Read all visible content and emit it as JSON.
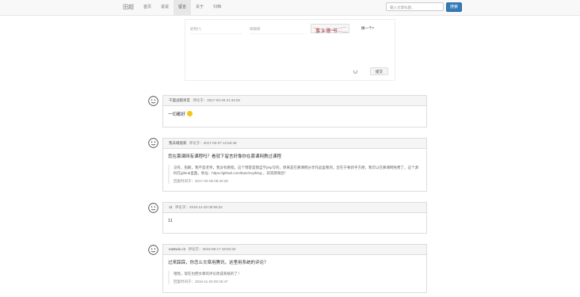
{
  "navbar": {
    "brand": "田超",
    "items": [
      {
        "label": "首页",
        "active": false
      },
      {
        "label": "说说",
        "active": false
      },
      {
        "label": "留言",
        "active": true
      },
      {
        "label": "关于",
        "active": false
      },
      {
        "label": "归档",
        "active": false
      }
    ],
    "search_placeholder": "输入文章标题...",
    "search_button": "搜索"
  },
  "comment_form": {
    "name_placeholder": "昵称(*)",
    "email_placeholder": "邮箱啊",
    "captcha_text": "事 9 歌 书",
    "captcha_refresh": "换一个?",
    "submit_label": "提交"
  },
  "comments": [
    {
      "user": "千面战猿男友",
      "meta": "评论于：2017-03-29 21:34:02",
      "text": "一切都好",
      "emoji": "grinning-emoji",
      "reply": null
    },
    {
      "user": "我去峨眉家",
      "meta": "评论于：2017-02-07 12:53:46",
      "text": "您在慕课网有课程吗？看就下留言好像你在慕课网教过课程",
      "reply": {
        "text": "没有，抱歉，我不是老师，我没有教程，这个博客是我自学php写的，原来是在慕课网分享作品里看到，您在于要新手方便，我可以在慕课网免费了，这个源码在github里面，地址：https://github.com/tianchoy/blog ，非常感谢您！",
        "time": "回复时间于：2017-02-08 08:30:28"
      }
    },
    {
      "user": "11",
      "meta": "评论于：2016-12-20 09:56:22",
      "text": "11",
      "reply": null
    },
    {
      "user": "eastwin.cn",
      "meta": "评论于：2016-08-17 18:03:40",
      "text": "过来踩踩，你怎么文章用腾讯，这里用系统的评论？",
      "reply": {
        "text": "哈哈，现在也把文章的评论改成系统的了！",
        "time": "回复时间于：2016-11-20 09:25:47"
      }
    }
  ]
}
